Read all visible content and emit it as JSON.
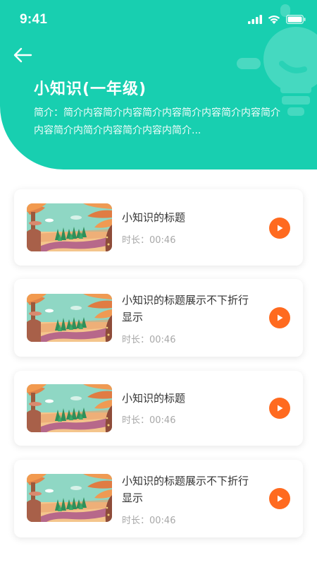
{
  "status": {
    "time": "9:41",
    "signal_icon": "cellular-signal-icon",
    "wifi_icon": "wifi-icon",
    "battery_icon": "battery-icon"
  },
  "header": {
    "back_icon": "arrow-left-icon",
    "decoration_icon": "lightbulb-icon",
    "title": "小知识(一年级)",
    "intro": "简介：简介内容简介内容简介内容简介内容简介内容简介内容简介内简介内容简介内容内简介..."
  },
  "colors": {
    "header_bg": "#18cfb0",
    "play_button": "#ff6a1f",
    "title_text": "#333333",
    "duration_text": "#a8a8a8"
  },
  "items": [
    {
      "title": "小知识的标题",
      "duration": "时长：00:46",
      "play_icon": "play-icon"
    },
    {
      "title": "小知识的标题展示不下折行显示",
      "duration": "时长：00:46",
      "play_icon": "play-icon"
    },
    {
      "title": "小知识的标题",
      "duration": "时长：00:46",
      "play_icon": "play-icon"
    },
    {
      "title": "小知识的标题展示不下折行显示",
      "duration": "时长：00:46",
      "play_icon": "play-icon"
    }
  ]
}
